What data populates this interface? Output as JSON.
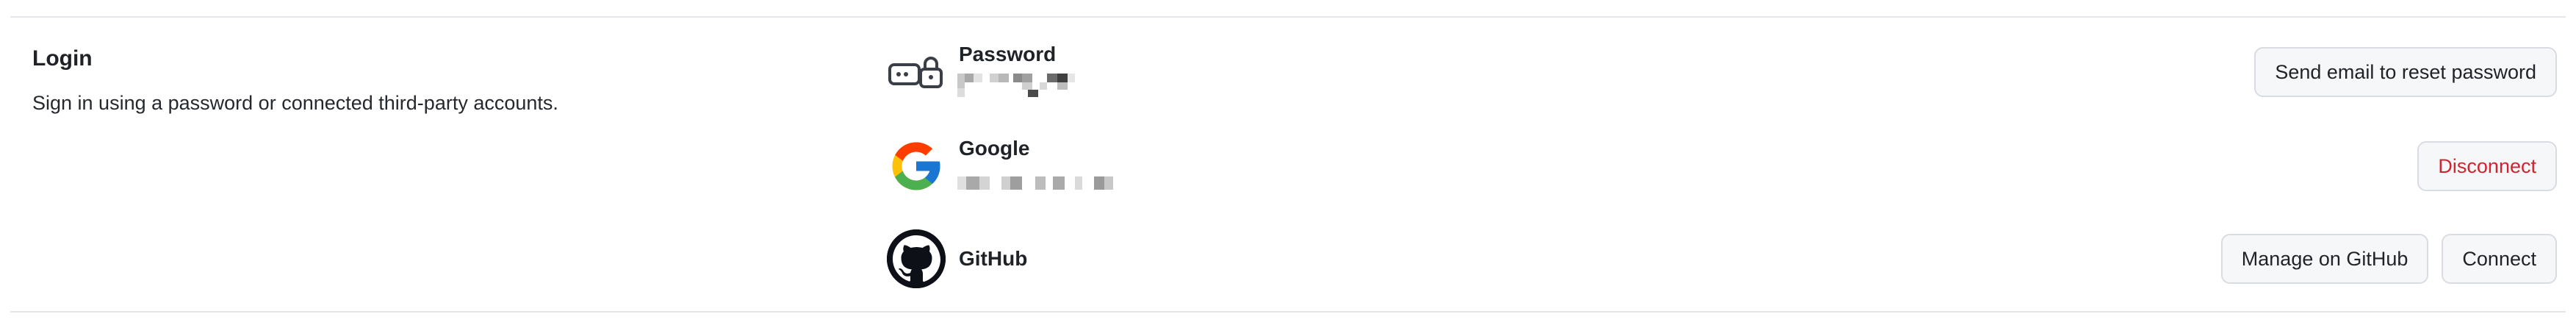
{
  "section": {
    "title": "Login",
    "description": "Sign in using a password or connected third-party accounts."
  },
  "providers": [
    {
      "name": "Password",
      "icon": "password-lock-icon",
      "detail_redacted": true,
      "actions": [
        "Send email to reset password"
      ]
    },
    {
      "name": "Google",
      "icon": "google-icon",
      "detail_redacted": true,
      "actions": [
        "Disconnect"
      ]
    },
    {
      "name": "GitHub",
      "icon": "github-icon",
      "actions": [
        "Manage on GitHub",
        "Connect"
      ]
    }
  ],
  "colors": {
    "danger": "#d1242f",
    "divider": "#e4e6ea",
    "button_bg": "#f6f7f9",
    "button_border": "#d9dce1"
  }
}
